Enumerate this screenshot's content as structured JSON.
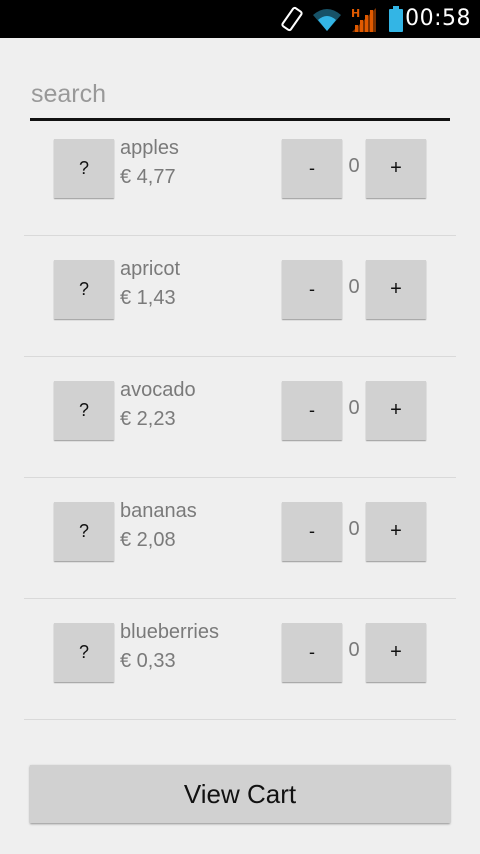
{
  "status_bar": {
    "time": "00:58",
    "network_type": "H",
    "icons": [
      "screen-rotation-icon",
      "wifi-icon",
      "cellular-signal-icon",
      "battery-icon"
    ],
    "wifi_color": "#33b5e5",
    "signal_color": "#e05a00",
    "battery_color": "#33b5e5"
  },
  "search": {
    "placeholder": "search",
    "value": ""
  },
  "items": [
    {
      "info_label": "?",
      "name": "apples",
      "price": "€ 4,77",
      "minus_label": "-",
      "quantity": "0",
      "plus_label": "+"
    },
    {
      "info_label": "?",
      "name": "apricot",
      "price": "€ 1,43",
      "minus_label": "-",
      "quantity": "0",
      "plus_label": "+"
    },
    {
      "info_label": "?",
      "name": "avocado",
      "price": "€ 2,23",
      "minus_label": "-",
      "quantity": "0",
      "plus_label": "+"
    },
    {
      "info_label": "?",
      "name": "bananas",
      "price": "€ 2,08",
      "minus_label": "-",
      "quantity": "0",
      "plus_label": "+"
    },
    {
      "info_label": "?",
      "name": "blueberries",
      "price": "€ 0,33",
      "minus_label": "-",
      "quantity": "0",
      "plus_label": "+"
    }
  ],
  "view_cart_label": "View Cart"
}
